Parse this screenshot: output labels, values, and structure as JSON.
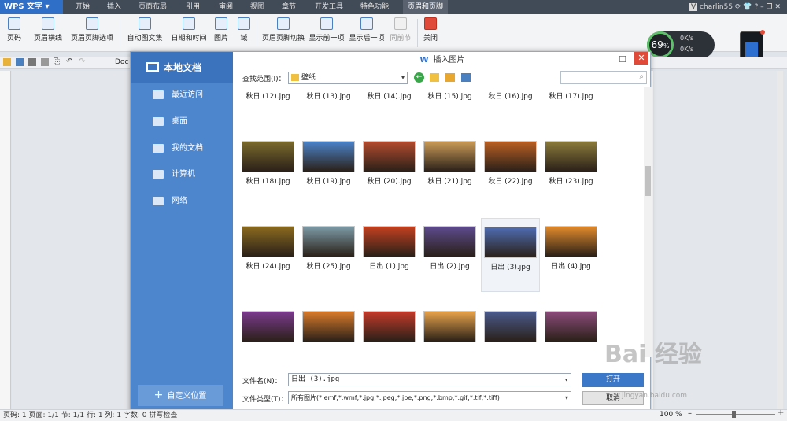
{
  "app": {
    "logo": "WPS 文字",
    "user": "charlin55",
    "user_badge": "V"
  },
  "menu": [
    "开始",
    "插入",
    "页面布局",
    "引用",
    "审阅",
    "视图",
    "章节",
    "开发工具",
    "特色功能",
    "页眉和页脚"
  ],
  "ribbon": {
    "buttons": [
      "页码",
      "页眉横线",
      "页眉页脚选项",
      "自动图文集",
      "日期和时间",
      "图片",
      "域",
      "页眉页脚切换",
      "显示前一项",
      "显示后一项",
      "同前节",
      "关闭"
    ]
  },
  "quickbar": {
    "doc_label": "Doc"
  },
  "gauge": {
    "percent": "69",
    "unit": "%",
    "up": "0K/s",
    "down": "0K/s"
  },
  "dialog": {
    "title": "插入图片",
    "side_header": "本地文档",
    "side_items": [
      "最近访问",
      "桌面",
      "我的文档",
      "计算机",
      "网络"
    ],
    "custom_location": "自定义位置",
    "scope_label": "查找范围(I)：",
    "scope_value": "壁纸",
    "filename_label": "文件名(N)：",
    "filename_value": "日出 (3).jpg",
    "filetype_label": "文件类型(T)：",
    "filetype_value": "所有图片(*.emf;*.wmf;*.jpg;*.jpeg;*.jpe;*.png;*.bmp;*.gif;*.tif;*.tiff)",
    "open_button": "打开",
    "cancel_button": "取消",
    "rows": [
      [
        {
          "name": "秋日 (12).jpg",
          "color": "#c06a2a"
        },
        {
          "name": "秋日 (13).jpg",
          "color": "#a8842e"
        },
        {
          "name": "秋日 (14).jpg",
          "color": "#b8612a"
        },
        {
          "name": "秋日 (15).jpg",
          "color": "#9c4a1c"
        },
        {
          "name": "秋日 (16).jpg",
          "color": "#6b4a33"
        },
        {
          "name": "秋日 (17).jpg",
          "color": "#c2542a"
        }
      ],
      [
        {
          "name": "秋日 (18).jpg",
          "color": "#7a6a2c"
        },
        {
          "name": "秋日 (19).jpg",
          "color": "#4a82c8"
        },
        {
          "name": "秋日 (20).jpg",
          "color": "#b24b2e"
        },
        {
          "name": "秋日 (21).jpg",
          "color": "#c99a56"
        },
        {
          "name": "秋日 (22).jpg",
          "color": "#b95f22"
        },
        {
          "name": "秋日 (23).jpg",
          "color": "#8a7a3a"
        }
      ],
      [
        {
          "name": "秋日 (24).jpg",
          "color": "#8a6a1e"
        },
        {
          "name": "秋日 (25).jpg",
          "color": "#7c9aa6"
        },
        {
          "name": "日出 (1).jpg",
          "color": "#c2401f"
        },
        {
          "name": "日出 (2).jpg",
          "color": "#5c4a8c"
        },
        {
          "name": "日出 (3).jpg",
          "color": "#4e6cb0"
        },
        {
          "name": "日出 (4).jpg",
          "color": "#e08a2c"
        }
      ],
      [
        {
          "name": "",
          "color": "#7a3a8c"
        },
        {
          "name": "",
          "color": "#d87a2a"
        },
        {
          "name": "",
          "color": "#c23a2a"
        },
        {
          "name": "",
          "color": "#e6a24a"
        },
        {
          "name": "",
          "color": "#4a5a8a"
        },
        {
          "name": "",
          "color": "#8a4a7a"
        }
      ]
    ],
    "selected_index": [
      2,
      4
    ]
  },
  "status": {
    "text": "页码: 1  页面: 1/1  节: 1/1  行: 1  列: 1  字数: 0  拼写检查",
    "zoom": "100 %"
  },
  "watermark": {
    "text": "Bai 经验",
    "sub": "jingyan.baidu.com"
  }
}
